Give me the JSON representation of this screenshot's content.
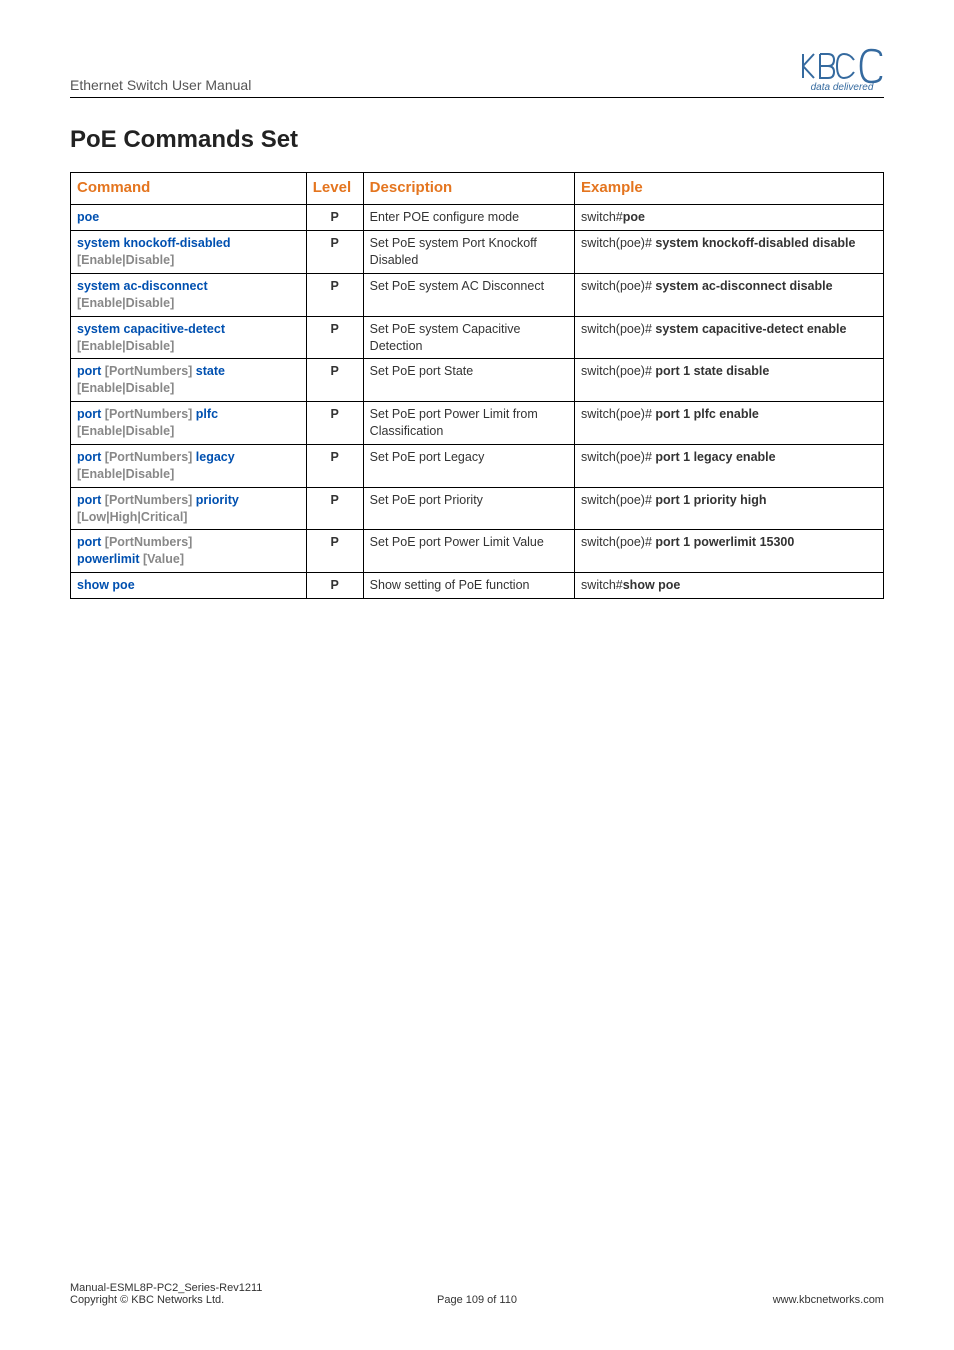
{
  "header": {
    "title": "Ethernet Switch User Manual",
    "tagline": "data delivered"
  },
  "section_title": "PoE Commands Set",
  "table": {
    "headers": {
      "command": "Command",
      "level": "Level",
      "description": "Description",
      "example": "Example"
    },
    "rows": [
      {
        "cmd_kw1": "poe",
        "cmd_param": "",
        "level": "P",
        "desc": "Enter POE configure mode",
        "ex_pre": "switch#",
        "ex_bold": "poe"
      },
      {
        "cmd_kw1": "system knockoff-disabled",
        "cmd_param": "[Enable|Disable]",
        "level": "P",
        "desc": "Set PoE system Port Knockoff Disabled",
        "ex_pre": "switch(poe)# ",
        "ex_bold": "system knockoff-disabled disable"
      },
      {
        "cmd_kw1": "system ac-disconnect",
        "cmd_param": "[Enable|Disable]",
        "level": "P",
        "desc": "Set PoE system AC Disconnect",
        "ex_pre": "switch(poe)# ",
        "ex_bold": "system ac-disconnect disable"
      },
      {
        "cmd_kw1": "system capacitive-detect",
        "cmd_param": "[Enable|Disable]",
        "level": "P",
        "desc": "Set PoE system Capacitive Detection",
        "ex_pre": "switch(poe)# ",
        "ex_bold": "system capacitive-detect enable"
      },
      {
        "cmd_kw1": "port",
        "cmd_param_mid": "[PortNumbers]",
        "cmd_kw2": "state",
        "cmd_param": "[Enable|Disable]",
        "level": "P",
        "desc": "Set PoE port State",
        "ex_pre": "switch(poe)# ",
        "ex_bold": "port 1 state disable"
      },
      {
        "cmd_kw1": "port",
        "cmd_param_mid": "[PortNumbers]",
        "cmd_kw2": "plfc",
        "cmd_param": "[Enable|Disable]",
        "level": "P",
        "desc": "Set PoE port Power Limit from Classification",
        "ex_pre": "switch(poe)# ",
        "ex_bold": "port 1 plfc enable"
      },
      {
        "cmd_kw1": "port",
        "cmd_param_mid": "[PortNumbers]",
        "cmd_kw2": "legacy",
        "cmd_param": "[Enable|Disable]",
        "level": "P",
        "desc": "Set PoE port Legacy",
        "ex_pre": "switch(poe)# ",
        "ex_bold": "port 1 legacy enable"
      },
      {
        "cmd_kw1": "port",
        "cmd_param_mid": "[PortNumbers]",
        "cmd_kw2": "priority",
        "cmd_param": "[Low|High|Critical]",
        "level": "P",
        "desc": "Set PoE port Priority",
        "ex_pre": "switch(poe)# ",
        "ex_bold": "port 1 priority high"
      },
      {
        "cmd_kw1": "port",
        "cmd_param_mid": "[PortNumbers]",
        "cmd_kw2": "",
        "cmd_line2_kw": "powerlimit",
        "cmd_line2_param": "[Value]",
        "level": "P",
        "desc": "Set PoE port Power Limit Value",
        "ex_pre": "switch(poe)# ",
        "ex_bold": "port 1 powerlimit 15300"
      },
      {
        "cmd_kw1": "show poe",
        "cmd_param": "",
        "level": "P",
        "desc": "Show setting of PoE function",
        "ex_pre": "switch#",
        "ex_bold": "show poe"
      }
    ]
  },
  "footer": {
    "line1": "Manual-ESML8P-PC2_Series-Rev1211",
    "line2": "Copyright © KBC Networks Ltd.",
    "page": "Page 109 of 110",
    "url": "www.kbcnetworks.com"
  }
}
